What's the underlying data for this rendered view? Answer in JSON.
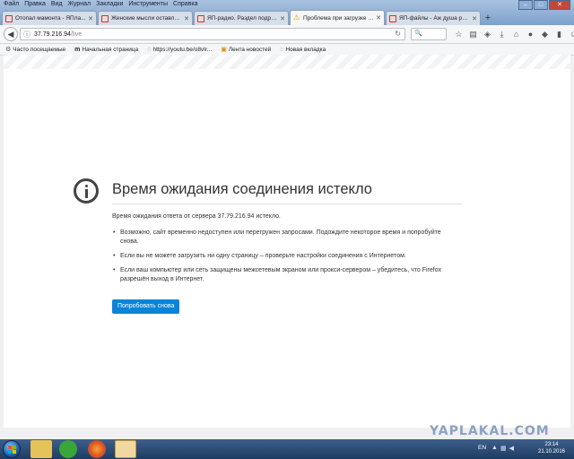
{
  "menu": [
    "Файл",
    "Правка",
    "Вид",
    "Журнал",
    "Закладки",
    "Инструменты",
    "Справка"
  ],
  "window_controls": {
    "minimize": "–",
    "maximize": "□",
    "close": "✕"
  },
  "tabs": [
    {
      "title": "Отопал мамонта - ЯПла...",
      "favicon": "yaplakal-icon",
      "active": false
    },
    {
      "title": "Женские мысли оставле...",
      "favicon": "yaplakal-icon",
      "active": false
    },
    {
      "title": "ЯП-радио. Раздел подре...",
      "favicon": "yaplakal-icon",
      "active": false
    },
    {
      "title": "Проблема при загрузке с...",
      "favicon": "warning-icon",
      "active": true
    },
    {
      "title": "ЯП-файлы - Аж душа рве...",
      "favicon": "yaplakal-icon",
      "active": false
    }
  ],
  "new_tab": "+",
  "url": {
    "host": "37.79.216.94",
    "path": "/live"
  },
  "bookmarks": [
    {
      "label": "Часто посещаемые",
      "icon": "gear-icon"
    },
    {
      "label": "Начальная страница",
      "icon": "m-logo-icon"
    },
    {
      "label": "https://youtu.be/o8vIr...",
      "icon": "globe-icon"
    },
    {
      "label": "Лента новостей",
      "icon": "rss-icon"
    },
    {
      "label": "Новая вкладка",
      "icon": "globe-icon"
    }
  ],
  "error": {
    "title": "Время ожидания соединения истекло",
    "description": "Время ожидания ответа от сервера 37.79.216.94 истекло.",
    "reasons": [
      "Возможно, сайт временно недоступен или перегружен запросами. Подождите некоторое время и попробуйте снова.",
      "Если вы не можете загрузить ни одну страницу – проверьте настройки соединения с Интернетом.",
      "Если ваш компьютер или сеть защищены межсетевым экраном или прокси-сервером – убедитесь, что Firefox разрешён выход в Интернет."
    ],
    "retry_label": "Попробовать снова"
  },
  "watermark": "YAPLAKAL.COM",
  "taskbar": {
    "language": "EN",
    "time": "23:14",
    "date": "21.10.2016"
  },
  "colors": {
    "accent_button": "#0b84d7",
    "taskbar": "#1d3c63"
  }
}
